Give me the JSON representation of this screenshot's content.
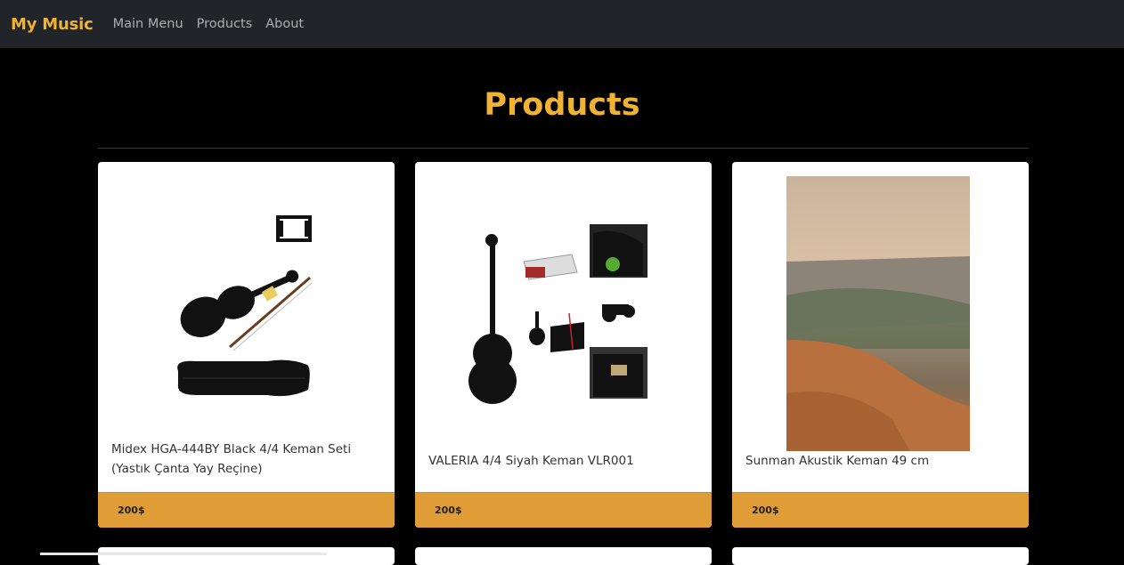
{
  "navbar": {
    "brand": "My Music",
    "links": [
      "Main Menu",
      "Products",
      "About"
    ]
  },
  "page": {
    "title": "Products"
  },
  "products": [
    {
      "title": "Midex HGA-444BY Black 4/4 Keman Seti (Yastık Çanta Yay Reçine)",
      "price": "200$"
    },
    {
      "title": "VALERIA 4/4 Siyah Keman VLR001",
      "price": "200$"
    },
    {
      "title": "Sunman Akustik Keman 49 cm",
      "price": "200$"
    }
  ],
  "colors": {
    "accent": "#f0b232",
    "navbar_bg": "#212529",
    "footer_bg": "#e09c36",
    "page_bg": "#000000"
  }
}
